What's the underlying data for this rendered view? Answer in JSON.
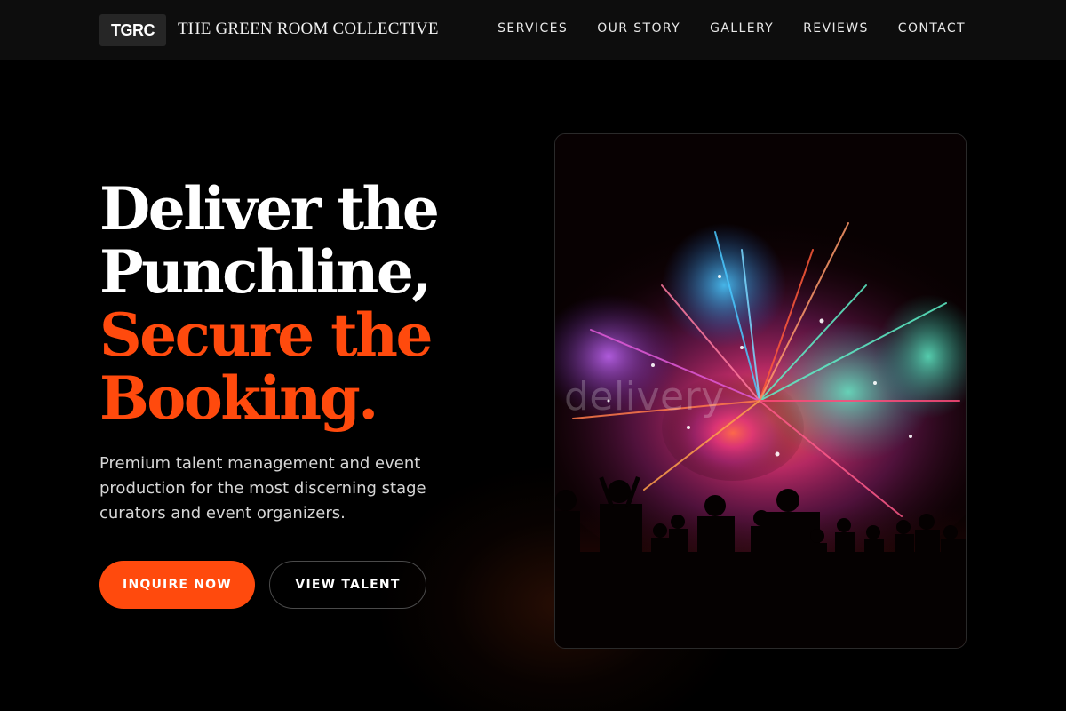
{
  "header": {
    "logo": "TGRC",
    "brand_name": "THE GREEN ROOM COLLECTIVE",
    "nav": [
      "SERVICES",
      "OUR STORY",
      "GALLERY",
      "REVIEWS",
      "CONTACT"
    ]
  },
  "hero": {
    "headline_line1": "Deliver the",
    "headline_line2": "Punchline,",
    "headline_line3": "Secure the",
    "headline_line4": "Booking.",
    "subtitle": "Premium talent management and event production for the most discerning stage curators and event organizers.",
    "primary_cta": "INQUIRE NOW",
    "secondary_cta": "VIEW TALENT"
  },
  "image": {
    "watermark": "delivery"
  },
  "colors": {
    "accent": "#ff4a0d",
    "background": "#000000",
    "header_bg": "#0d0d0d"
  }
}
